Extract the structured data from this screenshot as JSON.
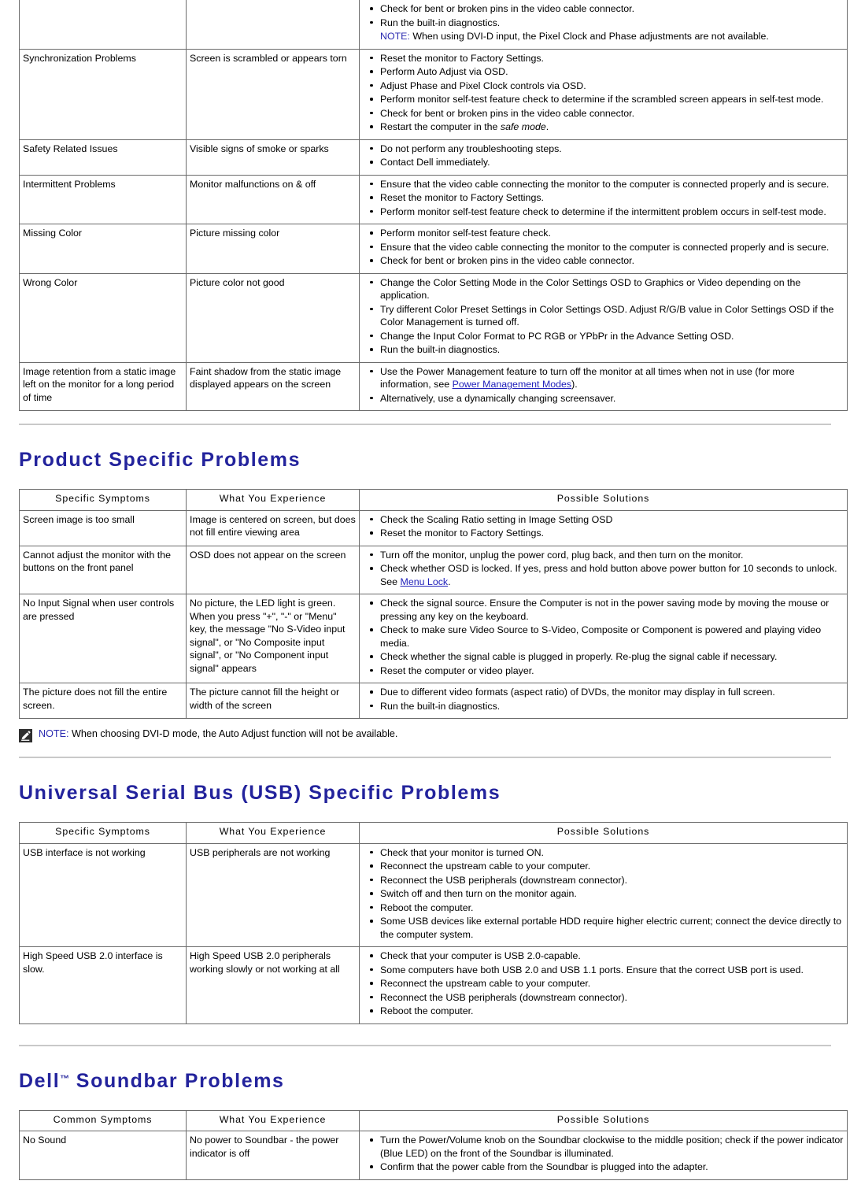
{
  "top_table": {
    "rows": [
      {
        "symptom": "",
        "experience": "",
        "solutions": [
          "Check for bent or broken pins in the video cable connector.",
          "Run the built-in diagnostics."
        ],
        "note_label": "NOTE:",
        "note_text": " When using DVI-D input, the Pixel Clock and Phase adjustments are not available."
      },
      {
        "symptom": "Synchronization Problems",
        "experience": "Screen is scrambled or appears torn",
        "solutions": [
          "Reset the monitor to Factory Settings.",
          "Perform Auto Adjust via OSD.",
          "Adjust Phase and Pixel Clock controls via OSD.",
          "Perform monitor self-test feature check to determine if the scrambled screen appears in self-test mode.",
          "Check for bent or broken pins in the video cable connector."
        ],
        "last_solution_pre": "Restart the computer in the ",
        "last_solution_italic": "safe mode",
        "last_solution_post": "."
      },
      {
        "symptom": "Safety Related Issues",
        "experience": "Visible signs of smoke or sparks",
        "solutions": [
          "Do not perform any troubleshooting steps.",
          "Contact Dell immediately."
        ]
      },
      {
        "symptom": "Intermittent Problems",
        "experience": "Monitor malfunctions on & off",
        "solutions": [
          "Ensure that the video cable connecting the monitor to the computer is connected properly and is secure.",
          "Reset the monitor to Factory Settings.",
          "Perform monitor self-test feature check to determine if the intermittent problem occurs in self-test mode."
        ]
      },
      {
        "symptom": "Missing Color",
        "experience": "Picture missing color",
        "solutions": [
          "Perform monitor self-test feature check.",
          "Ensure that the video cable connecting the monitor to the computer is connected properly and is secure.",
          "Check for bent or broken pins in the video cable connector."
        ]
      },
      {
        "symptom": "Wrong Color",
        "experience": "Picture color not good",
        "solutions": [
          "Change the Color Setting Mode in the Color Settings OSD to Graphics or Video depending on the application.",
          "Try different Color Preset Settings in Color Settings OSD. Adjust R/G/B value in Color Settings OSD if the Color Management is turned off.",
          "Change the Input Color Format to PC RGB or YPbPr in the Advance Setting OSD.",
          "Run the built-in diagnostics."
        ]
      },
      {
        "symptom": "Image retention from a static image left on the monitor for a long period of time",
        "experience": "Faint shadow from the static image displayed appears on the screen",
        "solution_pre": "Use the Power Management feature to turn off the monitor at all times when not in use (for more information, see ",
        "solution_link": "Power Management Modes",
        "solution_post": ").",
        "solution_last": "Alternatively, use a dynamically changing screensaver."
      }
    ]
  },
  "product_section": {
    "heading": "Product Specific Problems",
    "headers": {
      "col_a": "Specific Symptoms",
      "col_b": "What You Experience",
      "col_c": "Possible Solutions"
    },
    "rows": [
      {
        "symptom": "Screen image is too small",
        "experience": "Image is centered on screen, but does not fill entire viewing area",
        "solutions": [
          "Check the Scaling Ratio setting in Image Setting OSD",
          "Reset the monitor to Factory Settings."
        ]
      },
      {
        "symptom": "Cannot adjust the monitor with the buttons on the front panel",
        "experience": "OSD does not appear on the screen",
        "solutions": [
          "Turn off the monitor, unplug the power cord, plug back, and then turn on the monitor."
        ],
        "link_solution_pre": "Check whether OSD is locked. If yes, press and hold button above power button for 10 seconds to unlock. See ",
        "link_solution_link": "Menu Lock",
        "link_solution_post": "."
      },
      {
        "symptom": "No Input Signal when user controls are pressed",
        "experience": "No picture, the LED light is green. When you press \"+\", \"-\" or \"Menu\" key, the message \"No S-Video input signal\", or \"No Composite input signal\", or \"No Component input signal\" appears",
        "solutions": [
          "Check the signal source. Ensure the Computer is not in the power saving mode by moving the mouse or pressing any key on the keyboard.",
          "Check to make sure Video Source to S-Video, Composite or Component is powered and playing video media.",
          "Check whether the signal cable is plugged in properly. Re-plug the signal cable if necessary.",
          "Reset the computer or video player."
        ]
      },
      {
        "symptom": "The picture does not fill the entire screen.",
        "experience": "The picture cannot fill the height or width of the screen",
        "solutions": [
          "Due to different video formats (aspect ratio) of DVDs, the monitor may display in full screen.",
          "Run the built-in diagnostics."
        ]
      }
    ],
    "note": {
      "icon": "note-pencil-icon",
      "label": "NOTE:",
      "text": " When choosing DVI-D mode, the Auto Adjust function will not be available."
    }
  },
  "usb_section": {
    "heading": "Universal Serial Bus (USB) Specific Problems",
    "headers": {
      "col_a": "Specific Symptoms",
      "col_b": "What You Experience",
      "col_c": "Possible Solutions"
    },
    "rows": [
      {
        "symptom": "USB interface is not working",
        "experience": "USB peripherals are not working",
        "solutions": [
          "Check that your monitor is turned ON.",
          "Reconnect the upstream cable to your computer.",
          "Reconnect the USB peripherals (downstream connector).",
          "Switch off and then turn on the monitor again.",
          "Reboot the computer.",
          "Some USB devices like external portable HDD require higher electric current; connect the device directly to the computer system."
        ]
      },
      {
        "symptom": "High Speed USB 2.0 interface is slow.",
        "experience": "High Speed USB 2.0 peripherals working slowly or not working at all",
        "solutions": [
          "Check that your computer is USB 2.0-capable.",
          "Some computers have both USB 2.0 and USB 1.1 ports. Ensure that the correct USB port is used.",
          "Reconnect the upstream cable to your computer.",
          "Reconnect the USB peripherals (downstream connector).",
          "Reboot the computer."
        ]
      }
    ]
  },
  "soundbar_section": {
    "heading_pre": "Dell",
    "heading_tm": "™",
    "heading_post": " Soundbar Problems",
    "headers": {
      "col_a": "Common Symptoms",
      "col_b": "What You Experience",
      "col_c": "Possible Solutions"
    },
    "rows": [
      {
        "symptom": "No Sound",
        "experience": "No power to Soundbar - the power indicator is off",
        "solutions": [
          "Turn the Power/Volume knob on the Soundbar clockwise to the middle position; check if the power indicator (Blue LED) on the front of the Soundbar is illuminated.",
          "Confirm that the power cable from the Soundbar is plugged into the adapter."
        ]
      }
    ]
  },
  "colors": {
    "heading_blue": "#23239c",
    "link_blue": "#2222bb",
    "note_blue": "#2a2ab0",
    "border_gray": "#6b6b6b",
    "rule_gray": "#c9c9c9"
  }
}
